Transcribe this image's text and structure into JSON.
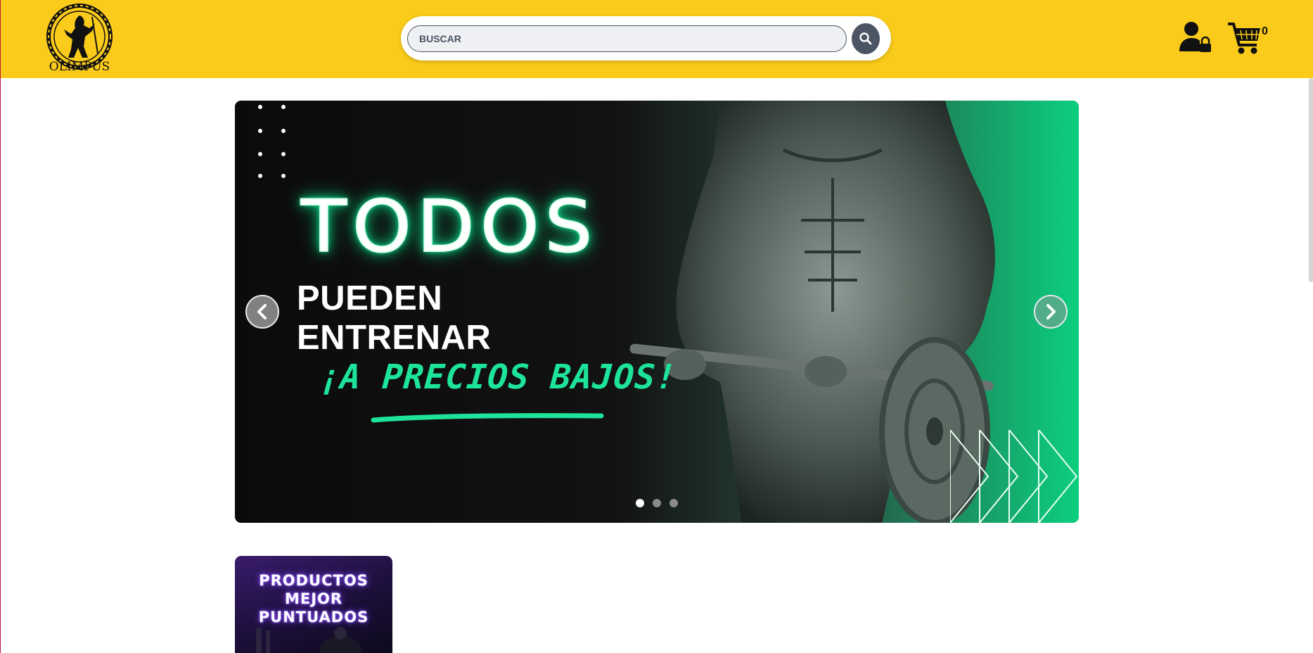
{
  "header": {
    "logo_text": "OLIMPUS",
    "search": {
      "placeholder": "BUSCAR",
      "value": ""
    },
    "search_button_icon": "search-icon",
    "user_icon": "user-lock-icon",
    "cart_icon": "shopping-cart-icon",
    "cart_count": "0"
  },
  "hero": {
    "line1": "TODOS",
    "line2": "PUEDEN ENTRENAR",
    "line3": "¡A PRECIOS BAJOS!",
    "prev_icon": "chevron-left-icon",
    "next_icon": "chevron-right-icon",
    "slides_total": 3,
    "active_slide": 1,
    "accent": "#1ee39a"
  },
  "promo": {
    "text": "PRODUCTOS MEJOR PUNTUADOS"
  },
  "colors": {
    "header_bg": "#facb1a",
    "search_button": "#4b5563",
    "promo_bg": "#3a1c6b"
  }
}
